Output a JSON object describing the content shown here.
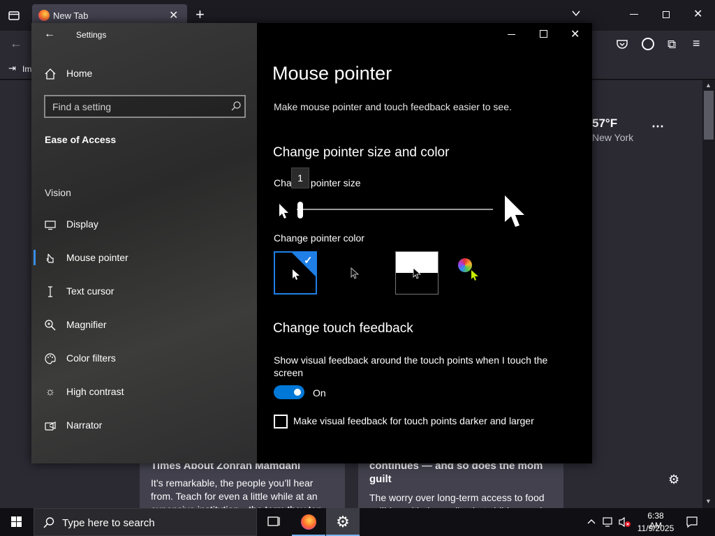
{
  "firefox": {
    "tab_title": "New Tab",
    "bookmark_label": "Im",
    "weather": {
      "temp": "57°F",
      "city": "New York"
    },
    "card_left": {
      "title": "Times About Zohran Mamdani",
      "body": "It’s remarkable, the people you’ll hear from. Teach for even a little while at an expensive institution—the term they ten"
    },
    "card_right": {
      "title_line1": "continues — and so does the mom",
      "title_line2": "guilt",
      "body": "The worry over long-term access to food collides with the reality that children and"
    }
  },
  "settings": {
    "window_title": "Settings",
    "nav": {
      "home": "Home",
      "search_placeholder": "Find a setting",
      "section": "Ease of Access",
      "group": "Vision",
      "items": [
        {
          "label": "Display",
          "icon": "monitor-icon"
        },
        {
          "label": "Mouse pointer",
          "icon": "mouse-pointer-icon"
        },
        {
          "label": "Text cursor",
          "icon": "text-cursor-icon"
        },
        {
          "label": "Magnifier",
          "icon": "magnifier-icon"
        },
        {
          "label": "Color filters",
          "icon": "color-filters-icon"
        },
        {
          "label": "High contrast",
          "icon": "high-contrast-icon"
        },
        {
          "label": "Narrator",
          "icon": "narrator-icon"
        }
      ]
    },
    "page": {
      "title": "Mouse pointer",
      "subtitle": "Make mouse pointer and touch feedback easier to see.",
      "size_heading": "Change pointer size and color",
      "size_label": "Change pointer size",
      "slider_value": "1",
      "color_label": "Change pointer color",
      "touch_heading": "Change touch feedback",
      "touch_desc": "Show visual feedback around the touch points when I touch the screen",
      "toggle_state": "On",
      "checkbox_label": "Make visual feedback for touch points darker and larger"
    },
    "accent": "#0078d7"
  },
  "taskbar": {
    "search_placeholder": "Type here to search",
    "time": "6:38 AM",
    "date": "11/9/2025"
  }
}
